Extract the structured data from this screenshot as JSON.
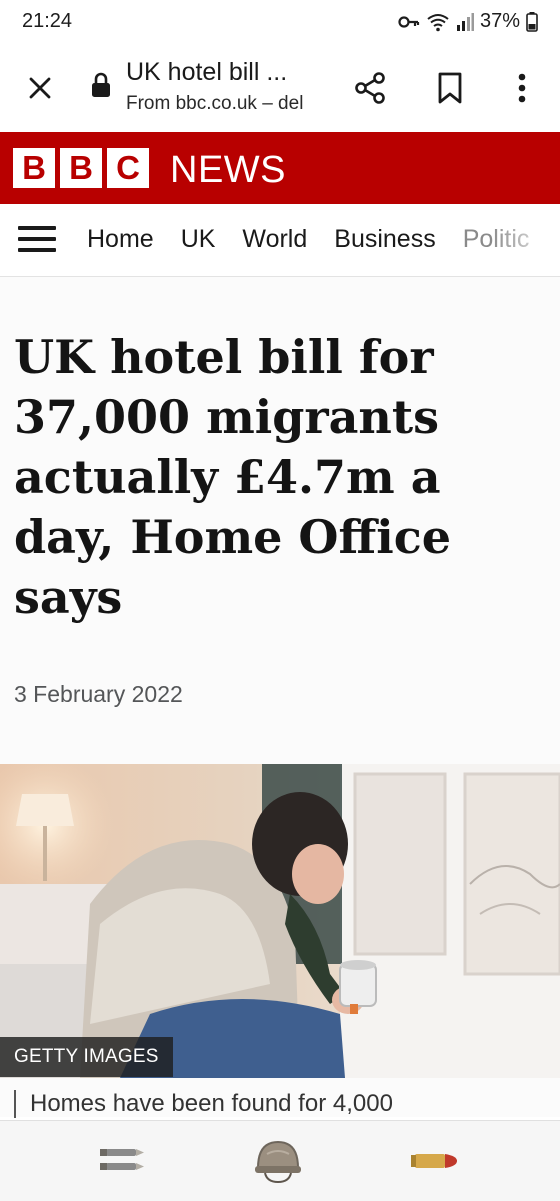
{
  "status_bar": {
    "time": "21:24",
    "battery": "37%",
    "icons": [
      "vpn-key-icon",
      "wifi-icon",
      "signal-icon",
      "battery-icon"
    ]
  },
  "custom_tab": {
    "title": "UK hotel bill ...",
    "url": "From bbc.co.uk – del",
    "icons": [
      "close-icon",
      "lock-icon",
      "share-icon",
      "bookmark-icon",
      "more-vert-icon"
    ]
  },
  "brand": {
    "logo_letters": [
      "B",
      "B",
      "C"
    ],
    "section": "NEWS",
    "color": "#b80000"
  },
  "nav": {
    "items": [
      "Home",
      "UK",
      "World",
      "Business",
      "Politic"
    ]
  },
  "article": {
    "headline": "UK hotel bill for 37,000 migrants actually £4.7m a day, Home Office says",
    "date": "3 February 2022",
    "image_credit": "GETTY IMAGES",
    "caption": "Homes have been found for 4,000"
  },
  "bottom_bar": {
    "icons": [
      "bullets-pair-icon",
      "helmet-icon",
      "bullet-icon"
    ]
  }
}
